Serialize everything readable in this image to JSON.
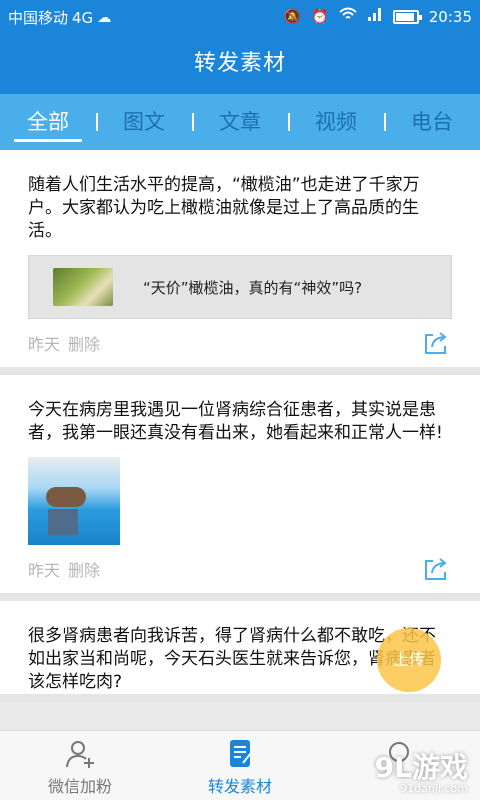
{
  "status_bar": {
    "carrier": "中国移动",
    "network": "4G",
    "time": "20:35",
    "icons": [
      "mute-icon",
      "alarm-icon",
      "wifi-icon",
      "signal-icon",
      "battery-icon"
    ]
  },
  "header": {
    "title": "转发素材"
  },
  "tabs": [
    {
      "label": "全部",
      "active": true
    },
    {
      "label": "图文",
      "active": false
    },
    {
      "label": "文章",
      "active": false
    },
    {
      "label": "视频",
      "active": false
    },
    {
      "label": "电台",
      "active": false
    }
  ],
  "feed": [
    {
      "text": "随着人们生活水平的提高，“橄榄油”也走进了千家万户。大家都认为吃上橄榄油就像是过上了高品质的生活。",
      "link_title": "“天价”橄榄油，真的有“神效”吗?",
      "date": "昨天",
      "delete": "删除"
    },
    {
      "text": "今天在病房里我遇见一位肾病综合征患者，其实说是患者，我第一眼还真没有看出来，她看起来和正常人一样!",
      "date": "昨天",
      "delete": "删除"
    },
    {
      "text": "很多肾病患者向我诉苦，得了肾病什么都不敢吃，还不如出家当和尚呢，今天石头医生就来告诉您，肾病患者该怎样吃肉?"
    }
  ],
  "upload_label": "上传",
  "bottom_nav": [
    {
      "label": "微信加粉",
      "icon": "add-user-icon",
      "active": false
    },
    {
      "label": "转发素材",
      "icon": "edit-doc-icon",
      "active": true
    },
    {
      "label": "",
      "icon": "search-icon",
      "active": false
    }
  ],
  "watermark": {
    "main": "9L游戏",
    "sub": "91danji.com"
  },
  "colors": {
    "brand": "#1b86d9",
    "tab_bar": "#4aaeea",
    "upload": "#fac446"
  }
}
